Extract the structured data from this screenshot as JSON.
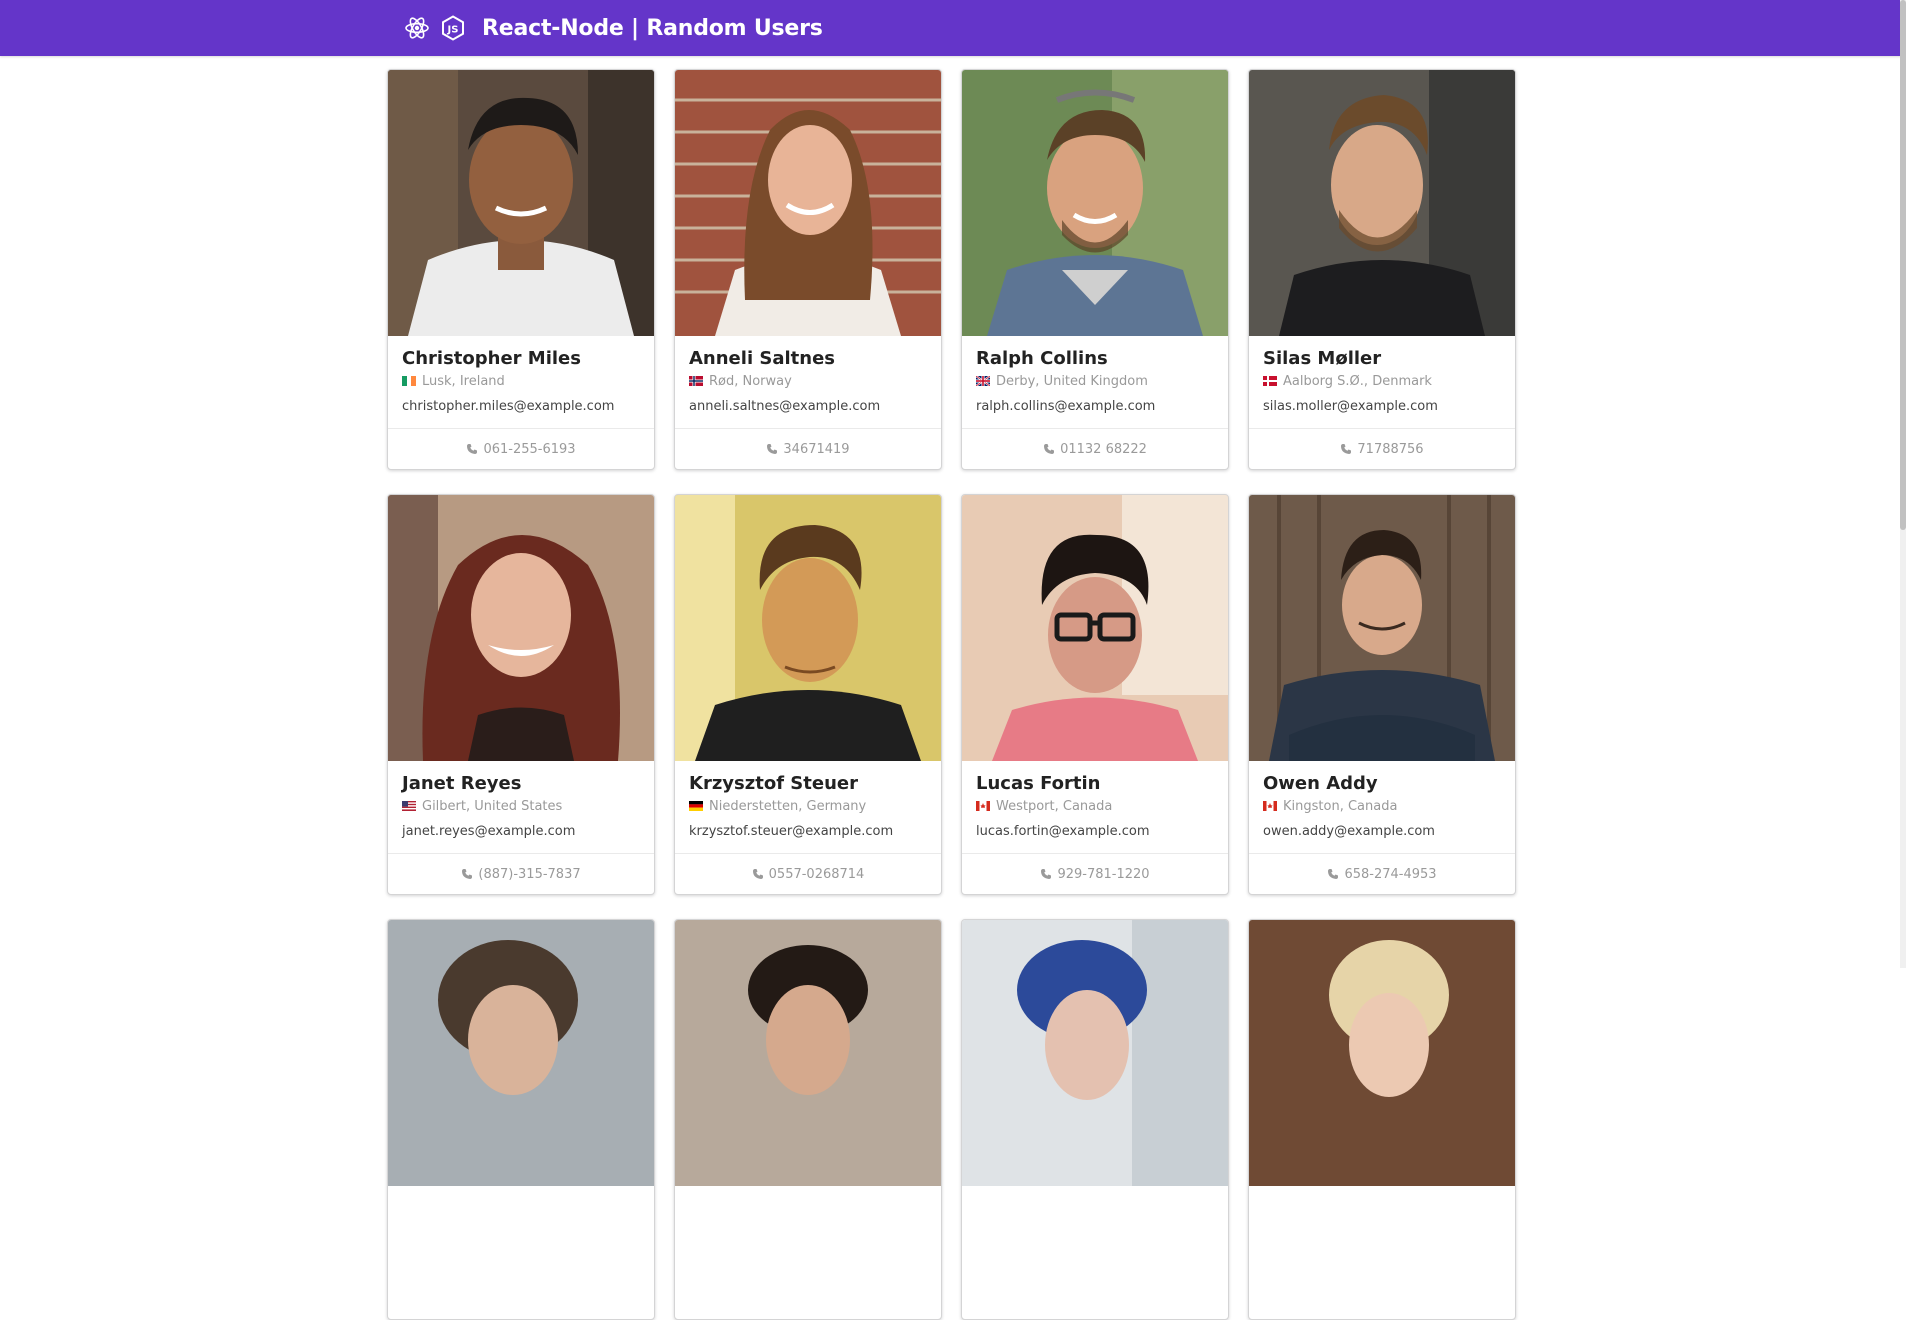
{
  "header": {
    "title": "React-Node | Random Users",
    "react_icon": "react-icon",
    "node_icon": "nodejs-icon",
    "bg_color": "#6435c9"
  },
  "users": [
    {
      "name": "Christopher Miles",
      "location": "Lusk, Ireland",
      "flag": "ireland-flag",
      "email": "christopher.miles@example.com",
      "phone": "061-255-6193"
    },
    {
      "name": "Anneli Saltnes",
      "location": "Rød, Norway",
      "flag": "norway-flag",
      "email": "anneli.saltnes@example.com",
      "phone": "34671419"
    },
    {
      "name": "Ralph Collins",
      "location": "Derby, United Kingdom",
      "flag": "uk-flag",
      "email": "ralph.collins@example.com",
      "phone": "01132 68222"
    },
    {
      "name": "Silas Møller",
      "location": "Aalborg S.Ø., Denmark",
      "flag": "denmark-flag",
      "email": "silas.moller@example.com",
      "phone": "71788756"
    },
    {
      "name": "Janet Reyes",
      "location": "Gilbert, United States",
      "flag": "usa-flag",
      "email": "janet.reyes@example.com",
      "phone": "(887)-315-7837"
    },
    {
      "name": "Krzysztof Steuer",
      "location": "Niederstetten, Germany",
      "flag": "germany-flag",
      "email": "krzysztof.steuer@example.com",
      "phone": "0557-0268714"
    },
    {
      "name": "Lucas Fortin",
      "location": "Westport, Canada",
      "flag": "canada-flag",
      "email": "lucas.fortin@example.com",
      "phone": "929-781-1220"
    },
    {
      "name": "Owen Addy",
      "location": "Kingston, Canada",
      "flag": "canada-flag",
      "email": "owen.addy@example.com",
      "phone": "658-274-4953"
    }
  ]
}
